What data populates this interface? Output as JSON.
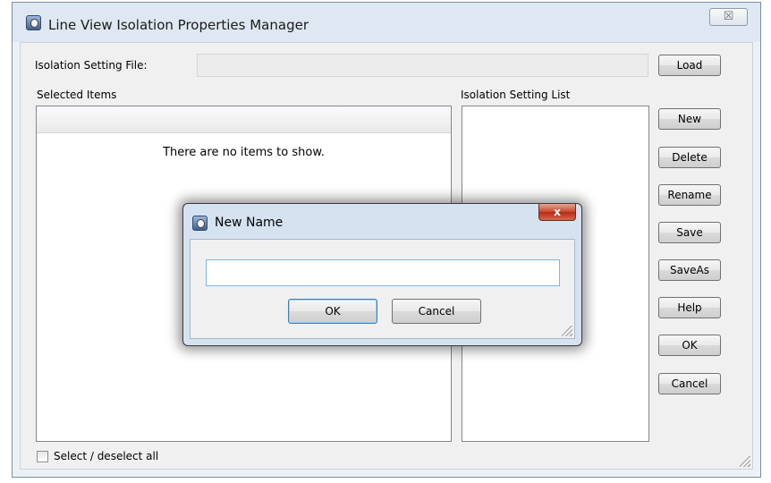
{
  "window": {
    "title": "Line View Isolation Properties Manager",
    "close_glyph": "☒",
    "icon": "app-icon"
  },
  "form": {
    "file_label": "Isolation Setting File:",
    "file_value": "",
    "load_label": "Load",
    "selected_items_label": "Selected Items",
    "empty_message": "There are no items to show.",
    "setting_list_label": "Isolation Setting List",
    "select_all_label": "Select / deselect all",
    "select_all_checked": false
  },
  "buttons": {
    "new": "New",
    "delete": "Delete",
    "rename": "Rename",
    "save": "Save",
    "saveas": "SaveAs",
    "help": "Help",
    "ok": "OK",
    "cancel": "Cancel"
  },
  "dialog": {
    "title": "New Name",
    "close_glyph": "x",
    "input_value": "",
    "ok_label": "OK",
    "cancel_label": "Cancel"
  },
  "colors": {
    "window_bg": "#ecf1f6",
    "dialog_frame": "#d5e3f1",
    "close_red": "#c7452e",
    "focus_blue": "#3c7fb1"
  }
}
